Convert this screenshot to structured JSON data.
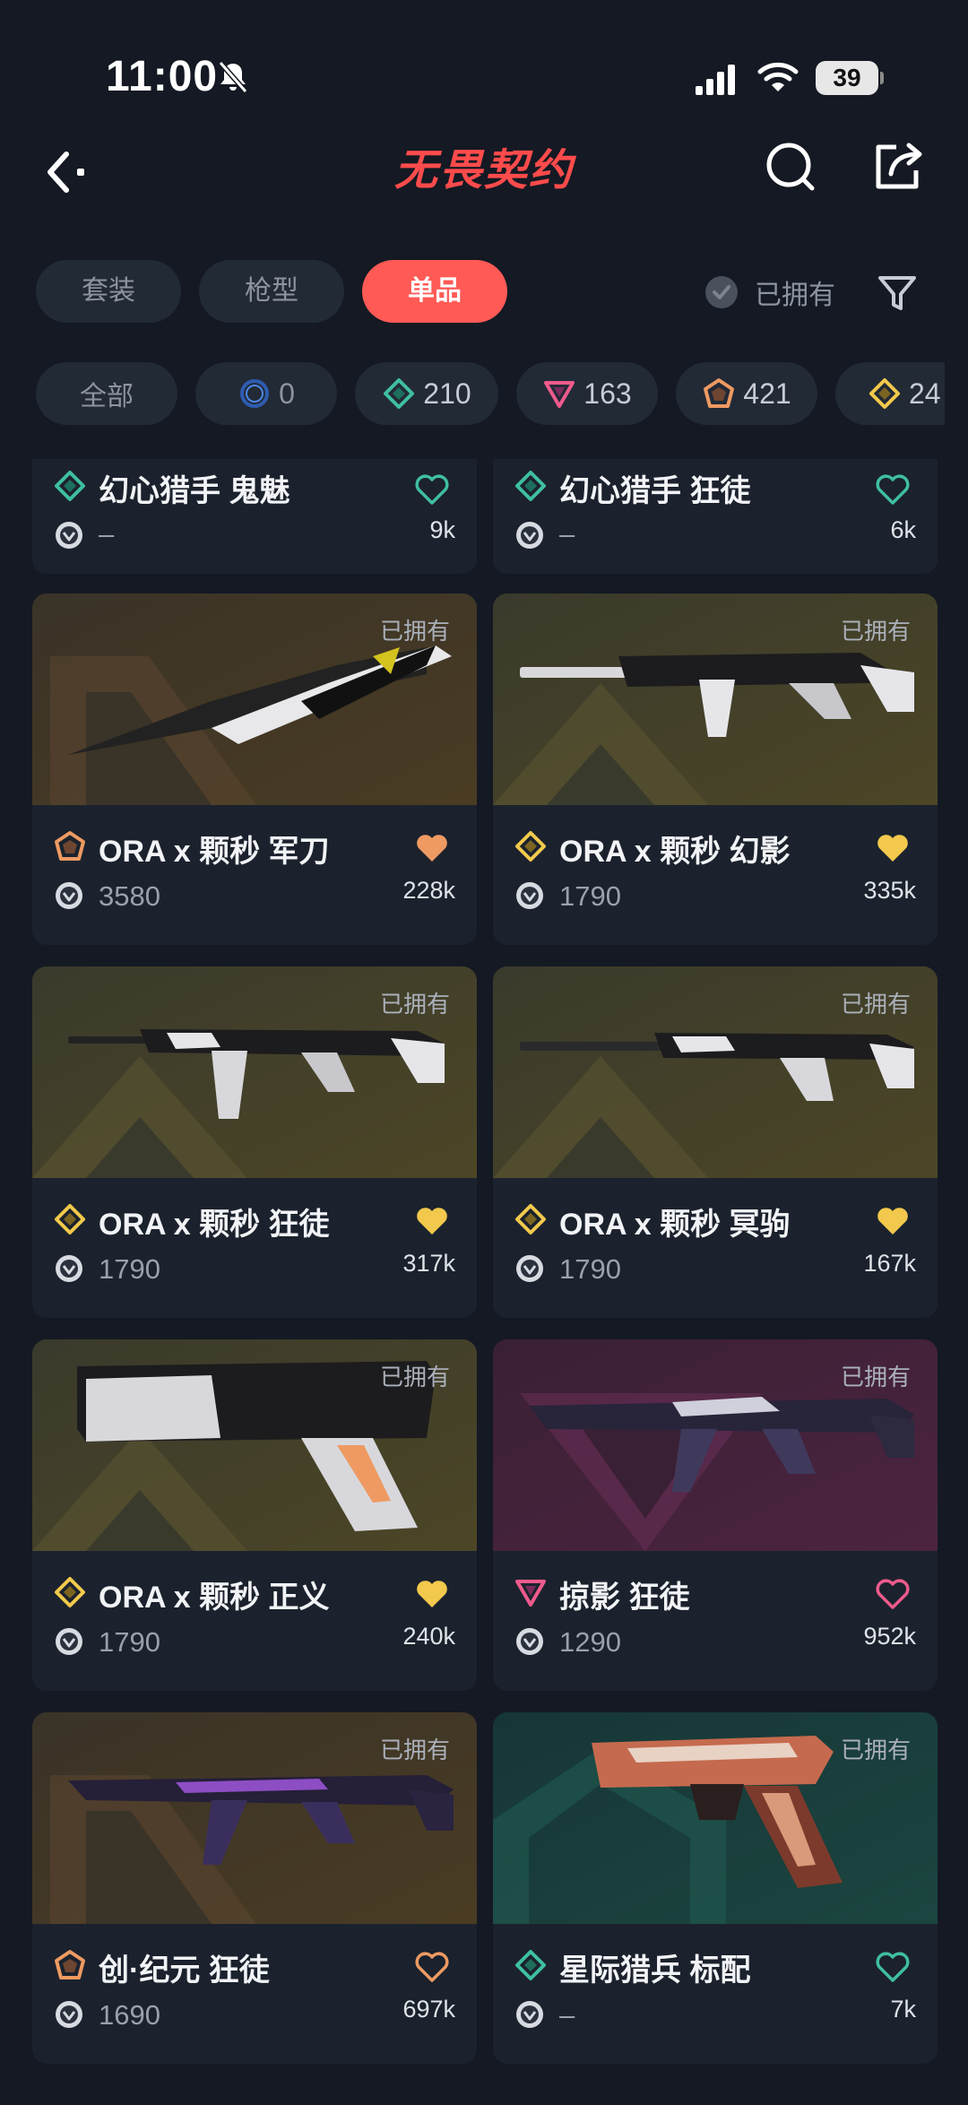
{
  "status_bar": {
    "time": "11:00",
    "battery": "39"
  },
  "header": {
    "title": "无畏契约"
  },
  "tabs": [
    {
      "label": "套装",
      "active": false
    },
    {
      "label": "枪型",
      "active": false
    },
    {
      "label": "单品",
      "active": true
    }
  ],
  "owned_filter": {
    "label": "已拥有"
  },
  "chips": [
    {
      "label": "全部"
    },
    {
      "count": "0",
      "tier": "blue"
    },
    {
      "count": "210",
      "tier": "green"
    },
    {
      "count": "163",
      "tier": "pink"
    },
    {
      "count": "421",
      "tier": "orange"
    },
    {
      "count": "24",
      "tier": "gold"
    }
  ],
  "items": [
    {
      "name": "幻心猎手 鬼魅",
      "price": "–",
      "likes": "9k",
      "tier": "green",
      "owned": false
    },
    {
      "name": "幻心猎手 狂徒",
      "price": "–",
      "likes": "6k",
      "tier": "green",
      "owned": false
    },
    {
      "name": "ORA x 颗秒 军刀",
      "price": "3580",
      "likes": "228k",
      "tier": "orange",
      "owned": true,
      "owned_label": "已拥有"
    },
    {
      "name": "ORA x 颗秒 幻影",
      "price": "1790",
      "likes": "335k",
      "tier": "gold",
      "owned": true,
      "owned_label": "已拥有"
    },
    {
      "name": "ORA x 颗秒 狂徒",
      "price": "1790",
      "likes": "317k",
      "tier": "gold",
      "owned": true,
      "owned_label": "已拥有"
    },
    {
      "name": "ORA x 颗秒 冥驹",
      "price": "1790",
      "likes": "167k",
      "tier": "gold",
      "owned": true,
      "owned_label": "已拥有"
    },
    {
      "name": "ORA x 颗秒 正义",
      "price": "1790",
      "likes": "240k",
      "tier": "gold",
      "owned": true,
      "owned_label": "已拥有"
    },
    {
      "name": "掠影 狂徒",
      "price": "1290",
      "likes": "952k",
      "tier": "pink",
      "owned": true,
      "owned_label": "已拥有"
    },
    {
      "name": "创·纪元 狂徒",
      "price": "1690",
      "likes": "697k",
      "tier": "orange",
      "owned": true,
      "owned_label": "已拥有"
    },
    {
      "name": "星际猎兵 标配",
      "price": "–",
      "likes": "7k",
      "tier": "green",
      "owned": true,
      "owned_label": "已拥有"
    }
  ],
  "colors": {
    "background": "#141923",
    "accent": "#ff5a55",
    "tier_green": "#3fbfa0",
    "tier_pink": "#ef5a8c",
    "tier_orange": "#ee9a62",
    "tier_gold": "#f2c94c",
    "tier_blue": "#3b74d8"
  }
}
